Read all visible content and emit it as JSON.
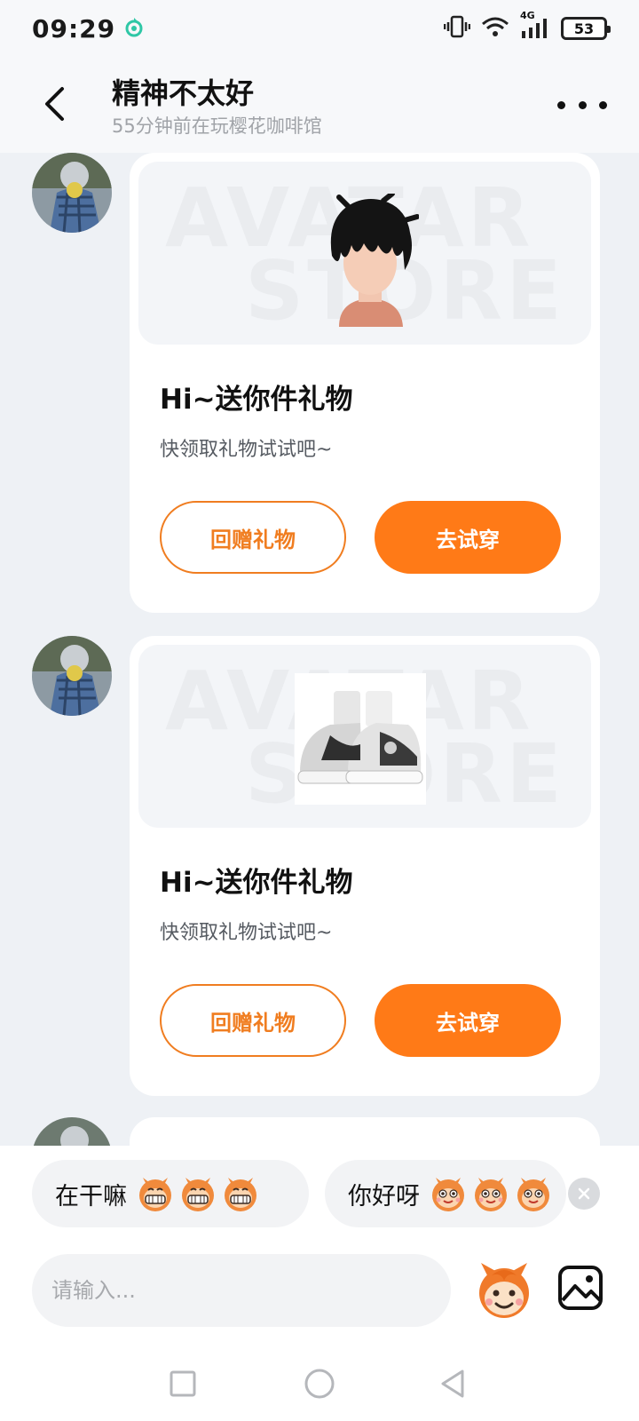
{
  "status_bar": {
    "time": "09:29",
    "network": "4G",
    "battery": "53"
  },
  "header": {
    "title": "精神不太好",
    "subtitle": "55分钟前在玩樱花咖啡馆"
  },
  "watermark": {
    "line1": "AVATAR",
    "line2": "STORE"
  },
  "messages": [
    {
      "item": "hair",
      "title": "Hi~送你件礼物",
      "subtitle": "快领取礼物试试吧~",
      "return_gift_label": "回赠礼物",
      "try_on_label": "去试穿"
    },
    {
      "item": "sneakers",
      "title": "Hi~送你件礼物",
      "subtitle": "快领取礼物试试吧~",
      "return_gift_label": "回赠礼物",
      "try_on_label": "去试穿"
    }
  ],
  "quick_replies": [
    {
      "text": "在干嘛",
      "emoji": "grin-monkey-icon"
    },
    {
      "text": "你好呀",
      "emoji": "smile-monkey-icon"
    }
  ],
  "input": {
    "placeholder": "请输入..."
  },
  "colors": {
    "accent": "#ff7a17",
    "outline": "#f07d20",
    "background": "#eef1f5"
  }
}
